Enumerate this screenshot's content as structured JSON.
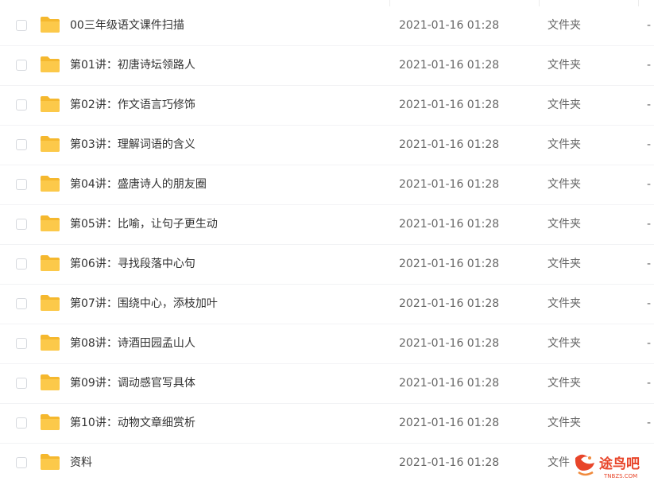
{
  "colors": {
    "folder": "#fcc94a",
    "folder_back": "#f5b82e",
    "text": "#333333",
    "meta": "#666666",
    "watermark": "#e8452a"
  },
  "rows": [
    {
      "name": "00三年级语文课件扫描",
      "date": "2021-01-16 01:28",
      "type": "文件夹",
      "size": "-",
      "icon": "folder-icon"
    },
    {
      "name": "第01讲：初唐诗坛领路人",
      "date": "2021-01-16 01:28",
      "type": "文件夹",
      "size": "-",
      "icon": "folder-icon"
    },
    {
      "name": "第02讲：作文语言巧修饰",
      "date": "2021-01-16 01:28",
      "type": "文件夹",
      "size": "-",
      "icon": "folder-icon"
    },
    {
      "name": "第03讲：理解词语的含义",
      "date": "2021-01-16 01:28",
      "type": "文件夹",
      "size": "-",
      "icon": "folder-icon"
    },
    {
      "name": "第04讲：盛唐诗人的朋友圈",
      "date": "2021-01-16 01:28",
      "type": "文件夹",
      "size": "-",
      "icon": "folder-icon"
    },
    {
      "name": "第05讲：比喻，让句子更生动",
      "date": "2021-01-16 01:28",
      "type": "文件夹",
      "size": "-",
      "icon": "folder-icon"
    },
    {
      "name": "第06讲：寻找段落中心句",
      "date": "2021-01-16 01:28",
      "type": "文件夹",
      "size": "-",
      "icon": "folder-icon"
    },
    {
      "name": "第07讲：围绕中心，添枝加叶",
      "date": "2021-01-16 01:28",
      "type": "文件夹",
      "size": "-",
      "icon": "folder-icon"
    },
    {
      "name": "第08讲：诗酒田园孟山人",
      "date": "2021-01-16 01:28",
      "type": "文件夹",
      "size": "-",
      "icon": "folder-icon"
    },
    {
      "name": "第09讲：调动感官写具体",
      "date": "2021-01-16 01:28",
      "type": "文件夹",
      "size": "-",
      "icon": "folder-icon"
    },
    {
      "name": "第10讲：动物文章细赏析",
      "date": "2021-01-16 01:28",
      "type": "文件夹",
      "size": "-",
      "icon": "folder-icon"
    },
    {
      "name": "资料",
      "date": "2021-01-16 01:28",
      "type": "文件",
      "size": "",
      "icon": "folder-icon"
    }
  ],
  "watermark": {
    "text": "途鸟吧",
    "subtext": "TNBZS.COM",
    "icon": "bird-logo-icon"
  }
}
